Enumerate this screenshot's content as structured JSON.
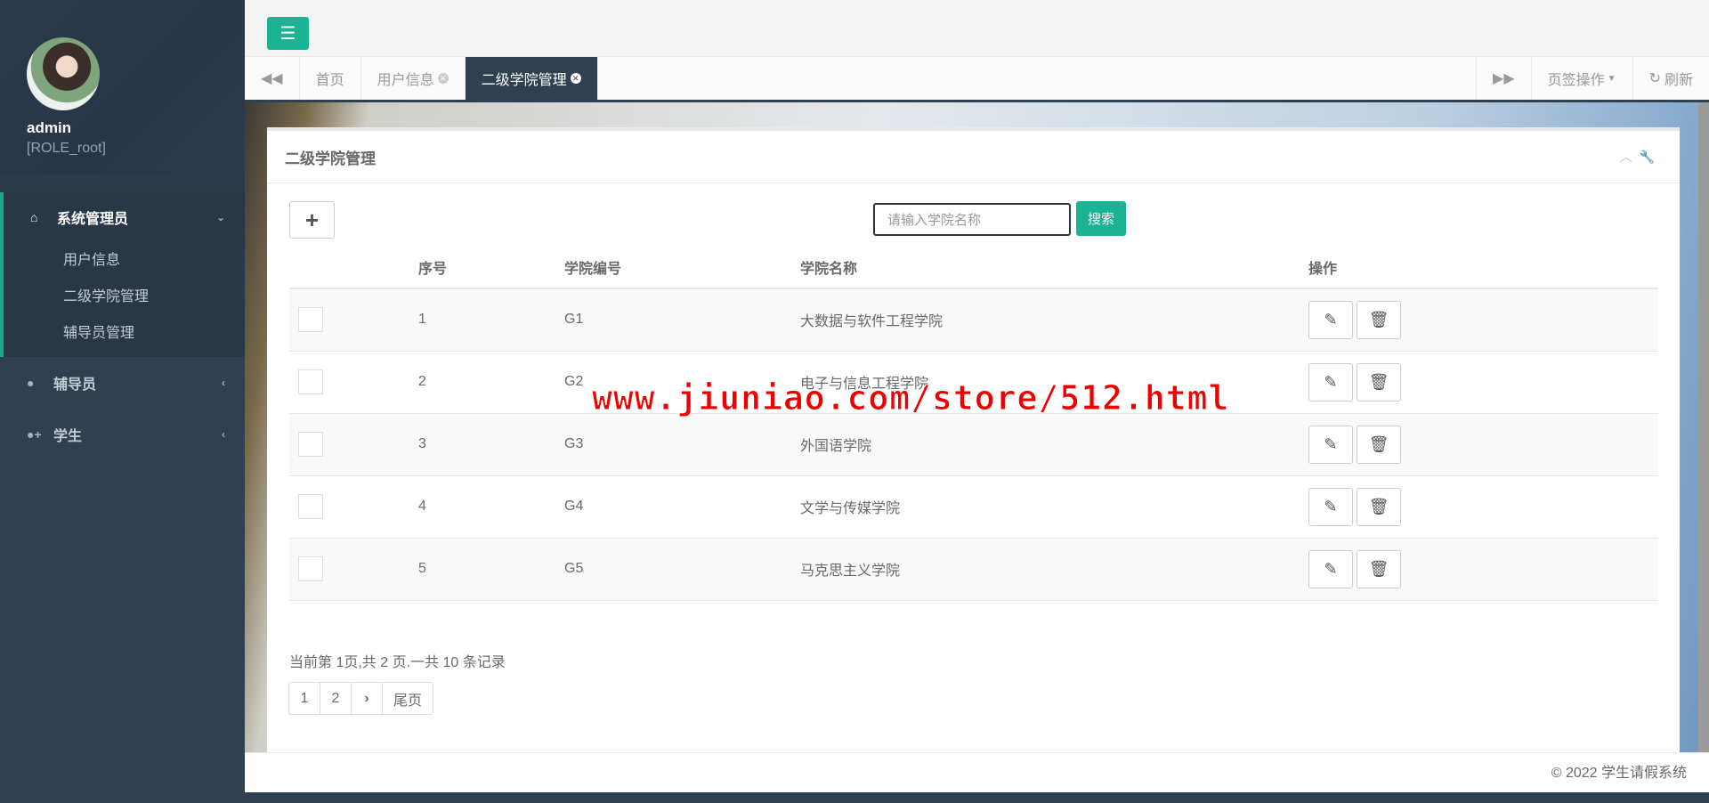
{
  "sidebar": {
    "user": "admin",
    "role": "[ROLE_root]",
    "group": {
      "label": "系统管理员",
      "items": [
        "用户信息",
        "二级学院管理",
        "辅导员管理"
      ]
    },
    "items": [
      {
        "label": "辅导员"
      },
      {
        "label": "学生"
      }
    ]
  },
  "tabs": {
    "items": [
      {
        "label": "首页"
      },
      {
        "label": "用户信息"
      },
      {
        "label": "二级学院管理"
      }
    ],
    "tab_ops": "页签操作",
    "refresh": "刷新"
  },
  "panel": {
    "title": "二级学院管理",
    "search_placeholder": "请输入学院名称",
    "search_label": "搜索",
    "columns": [
      "序号",
      "学院编号",
      "学院名称",
      "操作"
    ],
    "rows": [
      {
        "no": "1",
        "code": "G1",
        "name": "大数据与软件工程学院"
      },
      {
        "no": "2",
        "code": "G2",
        "name": "电子与信息工程学院"
      },
      {
        "no": "3",
        "code": "G3",
        "name": "外国语学院"
      },
      {
        "no": "4",
        "code": "G4",
        "name": "文学与传媒学院"
      },
      {
        "no": "5",
        "code": "G5",
        "name": "马克思主义学院"
      }
    ],
    "page_info": "当前第 1页,共 2 页.一共 10 条记录",
    "pages": [
      "1",
      "2"
    ],
    "last_label": "尾页"
  },
  "footer": "© 2022 学生请假系统",
  "watermark": "www.jiuniao.com/store/512.html",
  "colors": {
    "accent": "#1ab394",
    "sidebar": "#2f4050"
  }
}
